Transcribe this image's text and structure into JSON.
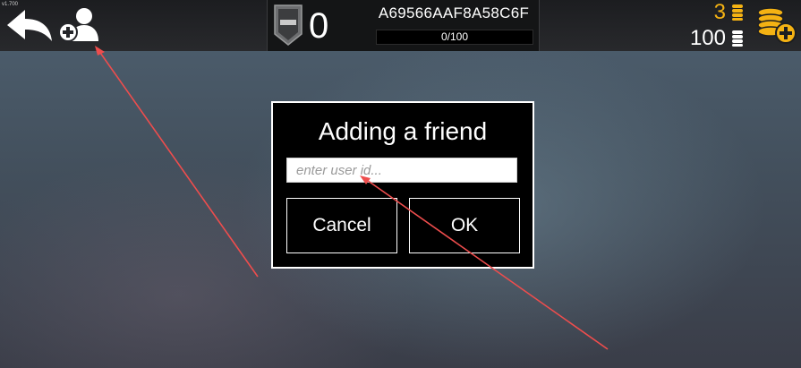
{
  "app": {
    "version": "v1.700"
  },
  "header": {
    "back_icon": "back-arrow-icon",
    "add_friend_icon": "add-friend-icon",
    "profile": {
      "rank_icon": "rank-shield-icon",
      "level": "0",
      "user_id": "A69566AAF8A58C6F",
      "xp_text": "0/100",
      "xp_progress": 0
    },
    "currency": {
      "gold_amount": "3",
      "gold_icon": "gold-coin-stack-icon",
      "silver_amount": "100",
      "silver_icon": "silver-coin-stack-icon",
      "shop_icon": "add-coins-icon",
      "gold_color": "#f4b213"
    }
  },
  "dialog": {
    "title": "Adding a friend",
    "input_placeholder": "enter user id...",
    "input_value": "",
    "cancel_label": "Cancel",
    "ok_label": "OK"
  },
  "annotations": {
    "arrow_color": "#ee4d4d"
  }
}
